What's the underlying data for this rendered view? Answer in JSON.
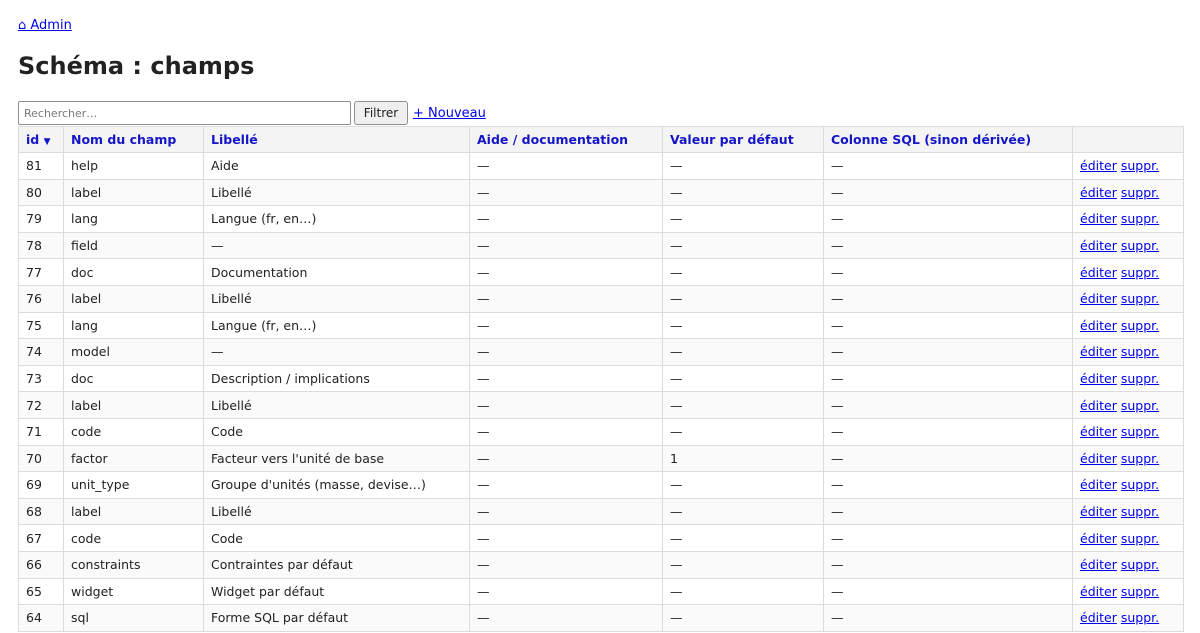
{
  "nav": {
    "home_label": "⌂ Admin"
  },
  "page": {
    "title": "Schéma : champs"
  },
  "toolbar": {
    "search_placeholder": "Rechercher…",
    "filter_label": "Filtrer",
    "new_label": "+ Nouveau"
  },
  "table": {
    "columns": [
      "id",
      "Nom du champ",
      "Libellé",
      "Aide / documentation",
      "Valeur par défaut",
      "Colonne SQL (sinon dérivée)",
      ""
    ],
    "sort_indicator": "▼",
    "rows": [
      {
        "id": "81",
        "name": "help",
        "label": "Aide",
        "doc": "—",
        "default": "—",
        "sql": "—"
      },
      {
        "id": "80",
        "name": "label",
        "label": "Libellé",
        "doc": "—",
        "default": "—",
        "sql": "—"
      },
      {
        "id": "79",
        "name": "lang",
        "label": "Langue (fr, en…)",
        "doc": "—",
        "default": "—",
        "sql": "—"
      },
      {
        "id": "78",
        "name": "field",
        "label": "—",
        "doc": "—",
        "default": "—",
        "sql": "—"
      },
      {
        "id": "77",
        "name": "doc",
        "label": "Documentation",
        "doc": "—",
        "default": "—",
        "sql": "—"
      },
      {
        "id": "76",
        "name": "label",
        "label": "Libellé",
        "doc": "—",
        "default": "—",
        "sql": "—"
      },
      {
        "id": "75",
        "name": "lang",
        "label": "Langue (fr, en…)",
        "doc": "—",
        "default": "—",
        "sql": "—"
      },
      {
        "id": "74",
        "name": "model",
        "label": "—",
        "doc": "—",
        "default": "—",
        "sql": "—"
      },
      {
        "id": "73",
        "name": "doc",
        "label": "Description / implications",
        "doc": "—",
        "default": "—",
        "sql": "—"
      },
      {
        "id": "72",
        "name": "label",
        "label": "Libellé",
        "doc": "—",
        "default": "—",
        "sql": "—"
      },
      {
        "id": "71",
        "name": "code",
        "label": "Code",
        "doc": "—",
        "default": "—",
        "sql": "—"
      },
      {
        "id": "70",
        "name": "factor",
        "label": "Facteur vers l'unité de base",
        "doc": "—",
        "default": "1",
        "sql": "—"
      },
      {
        "id": "69",
        "name": "unit_type",
        "label": "Groupe d'unités (masse, devise…)",
        "doc": "—",
        "default": "—",
        "sql": "—"
      },
      {
        "id": "68",
        "name": "label",
        "label": "Libellé",
        "doc": "—",
        "default": "—",
        "sql": "—"
      },
      {
        "id": "67",
        "name": "code",
        "label": "Code",
        "doc": "—",
        "default": "—",
        "sql": "—"
      },
      {
        "id": "66",
        "name": "constraints",
        "label": "Contraintes par défaut",
        "doc": "—",
        "default": "—",
        "sql": "—"
      },
      {
        "id": "65",
        "name": "widget",
        "label": "Widget par défaut",
        "doc": "—",
        "default": "—",
        "sql": "—"
      },
      {
        "id": "64",
        "name": "sql",
        "label": "Forme SQL par défaut",
        "doc": "—",
        "default": "—",
        "sql": "—"
      }
    ],
    "actions": {
      "edit": "éditer",
      "delete": "suppr."
    }
  },
  "colors": {
    "link": "#0000ee",
    "header_text": "#1515c8",
    "border": "#dcdcdc"
  }
}
